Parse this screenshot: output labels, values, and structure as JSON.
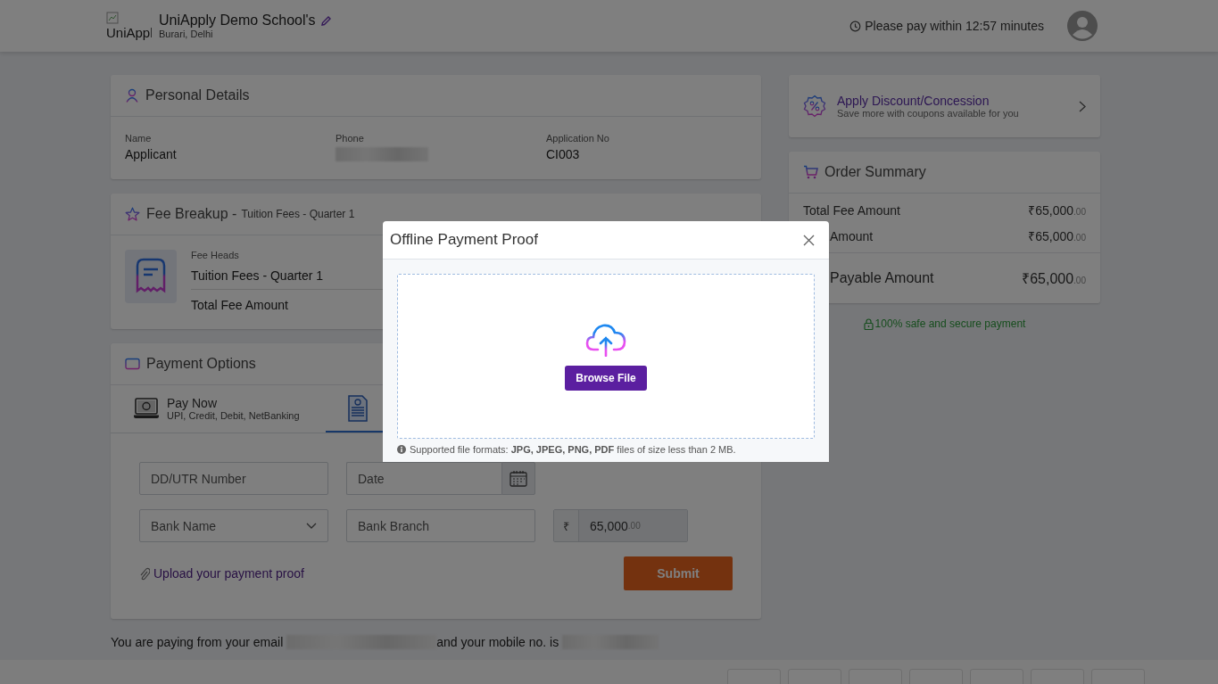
{
  "header": {
    "logo_alt": "UniAppl",
    "school": "UniApply Demo School's",
    "location": "Burari, Delhi",
    "timer": "Please pay within 12:57 minutes"
  },
  "personal_details": {
    "title": "Personal Details",
    "fields": [
      {
        "kind": "text",
        "label": "Name",
        "value": "Applicant"
      },
      {
        "kind": "redacted",
        "label": "Phone"
      },
      {
        "kind": "text",
        "label": "Application No",
        "value": "CI003"
      }
    ]
  },
  "fee_breakup": {
    "title": "Fee Breakup -",
    "subtitle": "Tuition Fees - Quarter 1",
    "heads_label": "Fee Heads",
    "items": [
      "Tuition Fees - Quarter 1",
      "Total Fee Amount"
    ]
  },
  "payment_options": {
    "title": "Payment Options",
    "tabs": [
      {
        "kind": "online",
        "label": "Pay Now",
        "sublabel": "UPI, Credit, Debit, NetBanking",
        "selected": false
      },
      {
        "kind": "offline",
        "selected": true
      }
    ],
    "form": {
      "dd_placeholder": "DD/UTR Number",
      "date_placeholder": "Date",
      "bank_placeholder": "Bank Name",
      "branch_placeholder": "Bank Branch",
      "currency": "₹",
      "amount": "65,000",
      "decimals": ".00",
      "upload_link": "Upload your payment proof",
      "submit": "Submit"
    }
  },
  "payer_note": {
    "before": "You are paying from your email",
    "middle": "and your mobile no. is"
  },
  "discount": {
    "title": "Apply Discount/Concession",
    "subtitle": "Save more with coupons available for you"
  },
  "order_summary": {
    "title": "Order Summary",
    "rows": [
      {
        "kind": "line",
        "label": "Total Fee Amount",
        "currency": "₹",
        "amount": "65,000",
        "decimals": ".00"
      },
      {
        "kind": "line",
        "label": "Amount",
        "currency": "₹",
        "amount": "65,000",
        "decimals": ".00"
      },
      {
        "kind": "total",
        "label": "Payable Amount",
        "currency": "₹",
        "amount": "65,000",
        "decimals": ".00"
      }
    ],
    "secure_note": "100% safe and secure payment"
  },
  "modal": {
    "title": "Offline Payment Proof",
    "button": "Browse File",
    "note": "Supported file formats: **JPG, JPEG, PNG, PDF** files of size less than 2 MB."
  }
}
